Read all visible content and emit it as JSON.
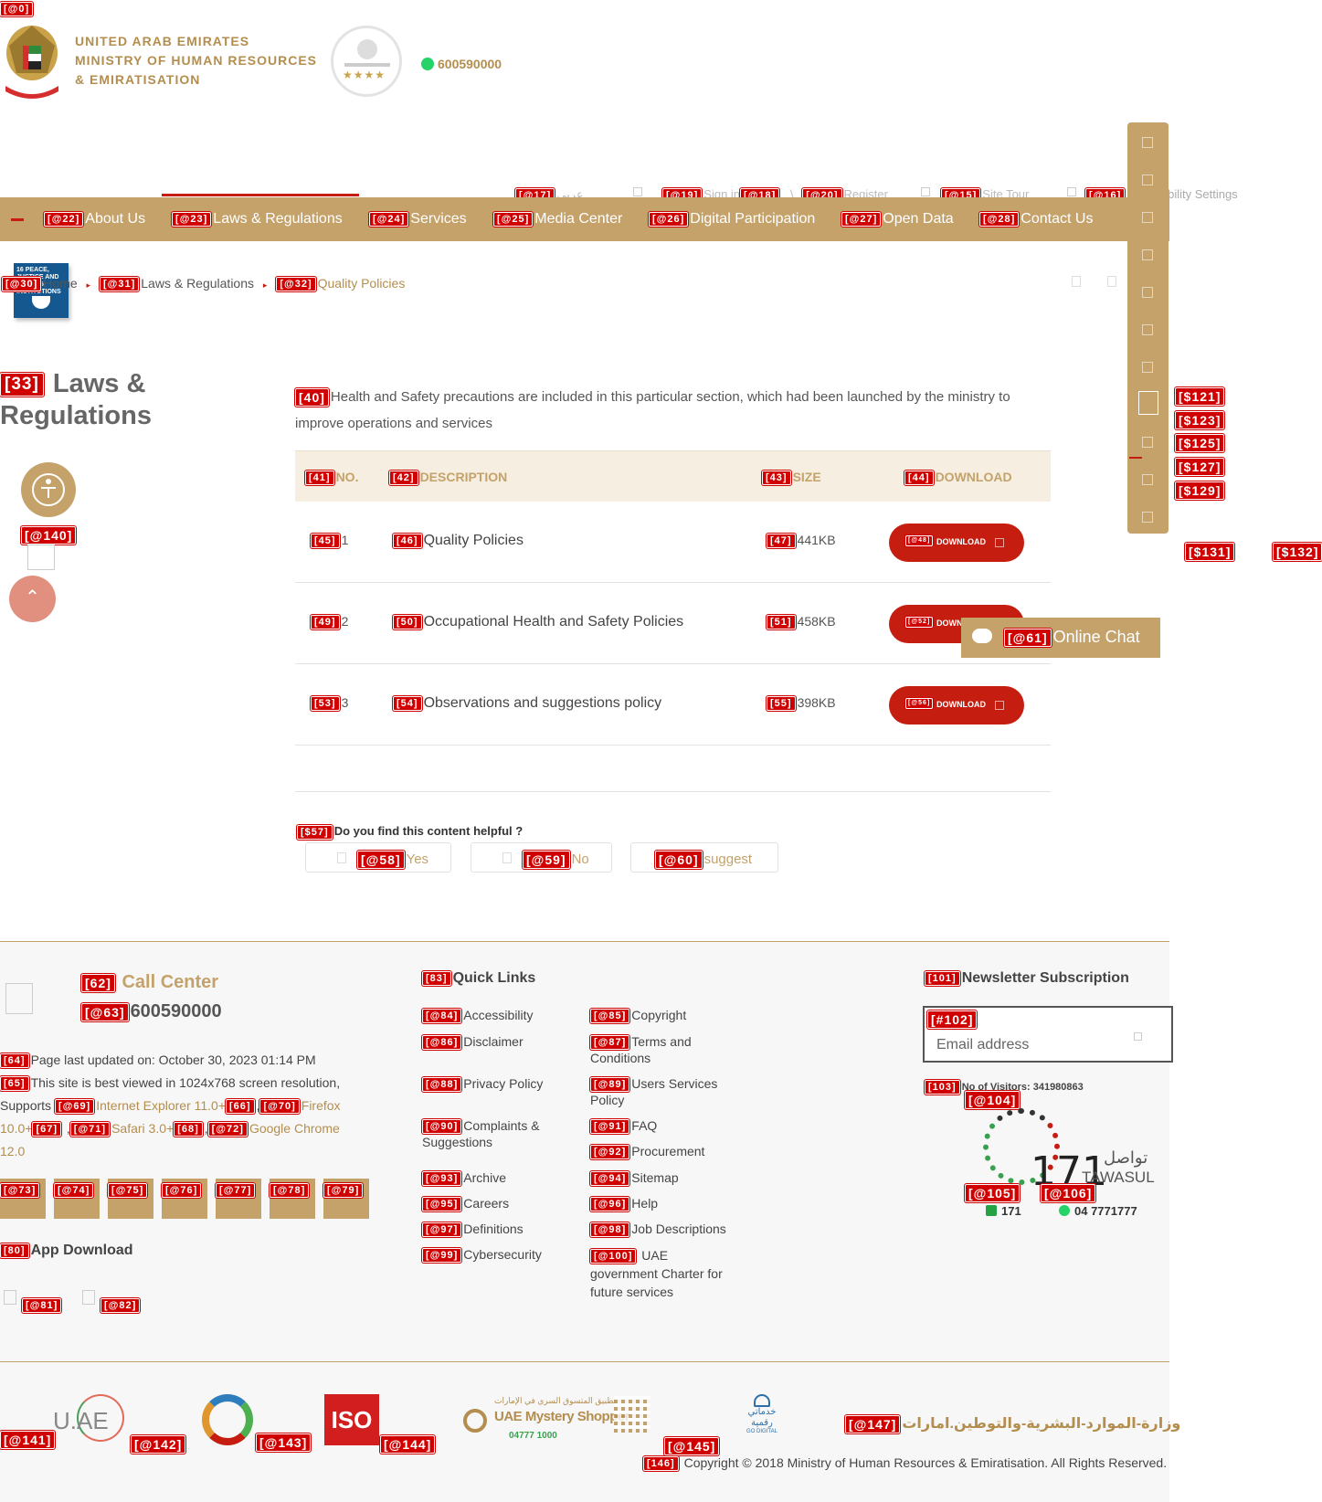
{
  "header": {
    "org_line1": "UNITED ARAB EMIRATES",
    "org_line2": "MINISTRY OF HUMAN RESOURCES",
    "org_line3": "& EMIRATISATION",
    "phone": "600590000",
    "badge_tag": "[@0]"
  },
  "topbar": {
    "arabic": "عربي",
    "signin": "Sign in",
    "separator": "\\",
    "register": "Register",
    "site_tour": "Site Tour",
    "accessibility": "Accessibility Settings",
    "tags": {
      "arabic": "[@17]",
      "signin": "[@19]",
      "signin2": "[@18]",
      "register": "[@20]",
      "tour": "[@15]",
      "access": "[@16]"
    }
  },
  "nav": {
    "items": [
      {
        "tag": "[@22]",
        "label": "About Us"
      },
      {
        "tag": "[@23]",
        "label": "Laws & Regulations"
      },
      {
        "tag": "[@24]",
        "label": "Services"
      },
      {
        "tag": "[@25]",
        "label": "Media Center"
      },
      {
        "tag": "[@26]",
        "label": "Digital Participation"
      },
      {
        "tag": "[@27]",
        "label": "Open Data"
      },
      {
        "tag": "[@28]",
        "label": "Contact Us"
      }
    ]
  },
  "breadcrumb": {
    "home_tag": "[@30]",
    "home": "Home",
    "laws_tag": "[@31]",
    "laws": "Laws & Regulations",
    "current_tag": "[@32]",
    "current": "Quality Policies",
    "sdg_text": "16 PEACE, JUSTICE AND STRONG INSTITUTIONS"
  },
  "sidebar": {
    "title_tag": "[33]",
    "title_line1": "Laws &",
    "title_line2": "Regulations",
    "icon_tag": "[@140]"
  },
  "intro": {
    "tag": "[40]",
    "text": "Health and Safety precautions are included in this particular section, which had been launched by the ministry to improve operations and services"
  },
  "table": {
    "headers": [
      {
        "tag": "[41]",
        "label": "NO."
      },
      {
        "tag": "[42]",
        "label": "DESCRIPTION"
      },
      {
        "tag": "[43]",
        "label": "SIZE"
      },
      {
        "tag": "[44]",
        "label": "DOWNLOAD"
      }
    ],
    "rows": [
      {
        "no_tag": "[45]",
        "no": "1",
        "desc_tag": "[46]",
        "desc": "Quality Policies",
        "size_tag": "[47]",
        "size": "441KB",
        "btn_tag": "[@48]",
        "btn": "DOWNLOAD"
      },
      {
        "no_tag": "[49]",
        "no": "2",
        "desc_tag": "[50]",
        "desc": "Occupational Health and Safety Policies",
        "size_tag": "[51]",
        "size": "458KB",
        "btn_tag": "[@52]",
        "btn": "DOWNLOAD"
      },
      {
        "no_tag": "[53]",
        "no": "3",
        "desc_tag": "[54]",
        "desc": "Observations and suggestions policy",
        "size_tag": "[55]",
        "size": "398KB",
        "btn_tag": "[@56]",
        "btn": "DOWNLOAD"
      }
    ]
  },
  "feedback": {
    "question_tag": "[$57]",
    "question": "Do you find this content helpful ?",
    "yes_tag": "[@58]",
    "yes": "Yes",
    "no_tag": "[@59]",
    "no": "No",
    "suggest_tag": "[@60]",
    "suggest": "suggest"
  },
  "chat": {
    "tag": "[@61]",
    "label": "Online Chat"
  },
  "side_tags": [
    "[$121]",
    "[$123]",
    "[$125]",
    "[$127]",
    "[$129]",
    "[$131]",
    "[$132]"
  ],
  "footer": {
    "call_tag": "[62]",
    "call_title": "Call Center",
    "call_num_tag": "[@63]",
    "call_number": "600590000",
    "updated_tag": "[64]",
    "updated": "Page last updated on: October 30, 2023 01:14 PM",
    "resolution_tag": "[65]",
    "resolution": "This site is best viewed in 1024x768 screen resolution,",
    "supports": "Supports",
    "browsers": {
      "ie_tag": "[@69]",
      "ie": "Internet Explorer 11.0+",
      "t66": "[66]",
      "ff_tag": "[@70]",
      "ff": "Firefox",
      "ff_ver": "10.0+",
      "t67": "[67]",
      "safari_tag": "[@71]",
      "safari": "Safari 3.0+",
      "t68": "[68]",
      "chrome_tag": "[@72]",
      "chrome": "Google Chrome",
      "chrome_ver": "12.0"
    },
    "social_tags": [
      "[@73]",
      "[@74]",
      "[@75]",
      "[@76]",
      "[@77]",
      "[@78]",
      "[@79]"
    ],
    "app_tag": "[80]",
    "app_title": "App Download",
    "app_tags": [
      "[@81]",
      "[@82]"
    ],
    "quick_tag": "[83]",
    "quick_title": "Quick Links",
    "links_left": [
      {
        "tag": "[@84]",
        "label": "Accessibility"
      },
      {
        "tag": "[@86]",
        "label": "Disclaimer"
      },
      {
        "tag": "[@88]",
        "label": "Privacy Policy"
      },
      {
        "tag": "[@90]",
        "label": "Complaints & Suggestions"
      },
      {
        "tag": "[@93]",
        "label": "Archive"
      },
      {
        "tag": "[@95]",
        "label": "Careers"
      },
      {
        "tag": "[@97]",
        "label": "Definitions"
      },
      {
        "tag": "[@99]",
        "label": "Cybersecurity"
      }
    ],
    "links_right": [
      {
        "tag": "[@85]",
        "label": "Copyright"
      },
      {
        "tag": "[@87]",
        "label": "Terms and Conditions"
      },
      {
        "tag": "[@89]",
        "label": "Users Services Policy"
      },
      {
        "tag": "[@91]",
        "label": "FAQ"
      },
      {
        "tag": "[@92]",
        "label": "Procurement"
      },
      {
        "tag": "[@94]",
        "label": "Sitemap"
      },
      {
        "tag": "[@96]",
        "label": "Help"
      },
      {
        "tag": "[@98]",
        "label": "Job Descriptions"
      },
      {
        "tag": "[@100]",
        "label": "UAE government Charter for future services"
      }
    ],
    "newsletter_tag": "[101]",
    "newsletter_title": "Newsletter Subscription",
    "email_tag": "[#102]",
    "email_placeholder": "Email address",
    "visitors_tag": "[103]",
    "visitors": "No of Visitors: 341980863",
    "tawasul_tag": "[@104]",
    "tawasul_ar": "تواصل",
    "tawasul_en": "TAWASUL",
    "tawasul_num": "171",
    "phone1_tag": "[@105]",
    "phone1": "171",
    "phone2_tag": "[@106]",
    "phone2": "04 7771777",
    "bottom_tags": [
      "[@141]",
      "[@142]",
      "[@143]",
      "[@144]",
      "[@145]"
    ],
    "uae_logo": "U.AE",
    "iso": "ISO",
    "mystery_ar": "تطبيق المتسوق السري في الإمارات",
    "mystery": "UAE Mystery Shopper",
    "mystery_phone": "04777 1000",
    "digital_ar": "خدماتي رقمية",
    "digital_en": "GO DIGITAL",
    "arabic_url_tag": "[@147]",
    "arabic_url": "وزارة-الموارد-البشرية-والتوطين.امارات",
    "copyright_tag": "[146]",
    "copyright": "Copyright © 2018 Ministry of Human Resources & Emiratisation. All Rights Reserved."
  },
  "colors": {
    "gold": "#c4a26a",
    "red": "#c51d10",
    "tag_red": "#d10000"
  }
}
